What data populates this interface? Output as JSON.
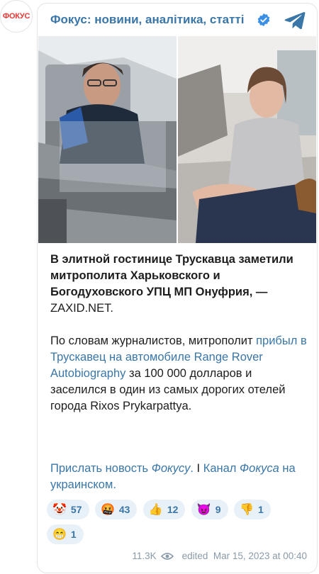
{
  "channel": {
    "avatar_text": "ФОКУС",
    "title": "Фокус: новини, аналітика, статті",
    "verified_icon": "verified-badge-icon",
    "share_icon": "telegram-icon"
  },
  "post": {
    "headline": "В элитной гостинице Трускавца заметили митрополита Харьковского и Богодуховского УПЦ МП Онуфрия, —",
    "source": "ZAXID.NET.",
    "p2_part1": "По словам журналистов, митрополит ",
    "p2_link": "прибыл в Трускавец на автомобиле Range Rover Autobiography",
    "p2_part2": " за 100 000 долларов и заселился в один из самых дорогих отелей города Rixos Prykarpattya.",
    "link1": "Прислать новость ",
    "link1_italic": "Фокусу",
    "link1_end": ".",
    "separator": " I ",
    "link2": "Канал ",
    "link2_italic": "Фокуса",
    "link2_end": " на украинском."
  },
  "reactions": [
    {
      "emoji": "🤡",
      "count": "57"
    },
    {
      "emoji": "🤬",
      "count": "43"
    },
    {
      "emoji": "👍",
      "count": "12"
    },
    {
      "emoji": "😈",
      "count": "9"
    },
    {
      "emoji": "👎",
      "count": "1"
    },
    {
      "emoji": "😁",
      "count": "1"
    }
  ],
  "footer": {
    "views": "11.3K",
    "edited_label": "edited",
    "date": "Mar 15, 2023 at 00:40"
  },
  "colors": {
    "accent": "#3a76a8",
    "brand_red": "#e53935",
    "reaction_bg": "#e8f0f8"
  }
}
